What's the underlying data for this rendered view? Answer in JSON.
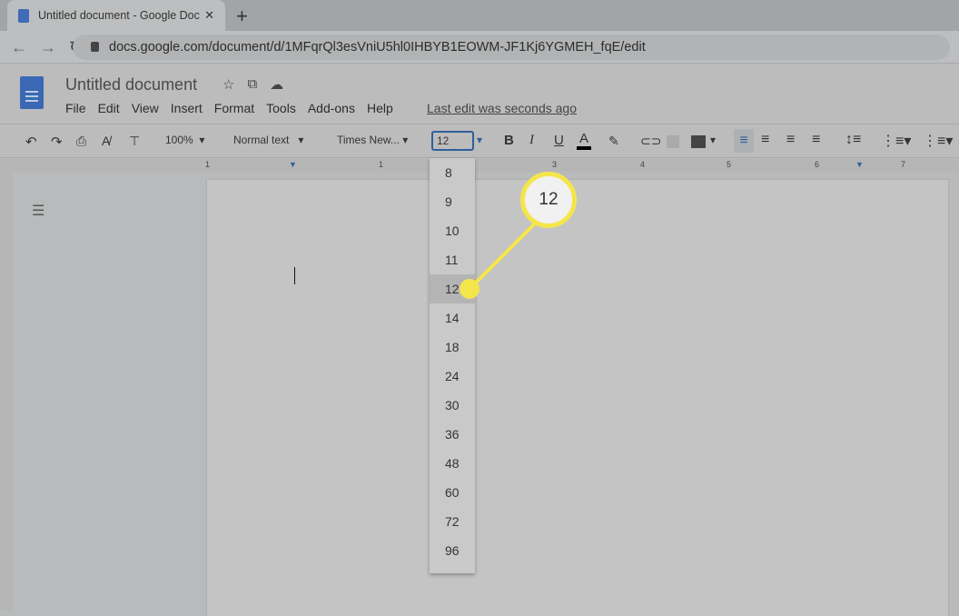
{
  "browser": {
    "tab_title": "Untitled document - Google Doc",
    "url": "docs.google.com/document/d/1MFqrQl3esVniU5hl0IHBYB1EOWM-JF1Kj6YGMEH_fqE/edit"
  },
  "doc": {
    "title": "Untitled document",
    "menu": [
      "File",
      "Edit",
      "View",
      "Insert",
      "Format",
      "Tools",
      "Add-ons",
      "Help"
    ],
    "last_edit": "Last edit was seconds ago"
  },
  "toolbar": {
    "zoom": "100%",
    "style": "Normal text",
    "font": "Times New...",
    "font_size": "12",
    "bold": "B",
    "italic": "I",
    "underline": "U",
    "text_color": "A"
  },
  "ruler": [
    "1",
    "1",
    "3",
    "4",
    "5",
    "6",
    "7"
  ],
  "font_size_options": [
    "8",
    "9",
    "10",
    "11",
    "12",
    "14",
    "18",
    "24",
    "30",
    "36",
    "48",
    "60",
    "72",
    "96"
  ],
  "selected_size": "12",
  "callout": "12",
  "colors": {
    "highlight": "#f4e64a",
    "accent": "#2f5f9a"
  }
}
